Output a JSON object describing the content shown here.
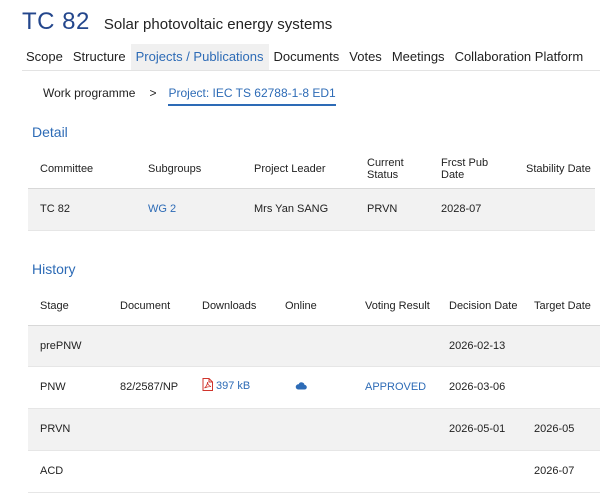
{
  "header": {
    "code": "TC 82",
    "title": "Solar photovoltaic energy systems"
  },
  "tabs": [
    "Scope",
    "Structure",
    "Projects / Publications",
    "Documents",
    "Votes",
    "Meetings",
    "Collaboration Platform"
  ],
  "active_tab": "Projects / Publications",
  "breadcrumb": {
    "home": "Work programme",
    "separator": ">",
    "current": "Project: IEC TS 62788-1-8 ED1"
  },
  "detail": {
    "title": "Detail",
    "headers": [
      "Committee",
      "Subgroups",
      "Project Leader",
      "Current Status",
      "Frcst Pub Date",
      "Stability Date"
    ],
    "row": {
      "committee": "TC 82",
      "subgroup": "WG 2",
      "leader": "Mrs Yan SANG",
      "status": "PRVN",
      "pub_date": "2028-07",
      "stability": ""
    }
  },
  "history": {
    "title": "History",
    "headers": [
      "Stage",
      "Document",
      "Downloads",
      "Online",
      "Voting Result",
      "Decision Date",
      "Target Date"
    ],
    "rows": [
      {
        "stage": "prePNW",
        "document": "",
        "download": "",
        "online": "",
        "voting": "",
        "decision": "2026-02-13",
        "target": ""
      },
      {
        "stage": "PNW",
        "document": "82/2587/NP",
        "download": "397 kB",
        "online": "cloud-icon",
        "voting": "APPROVED",
        "decision": "2026-03-06",
        "target": ""
      },
      {
        "stage": "PRVN",
        "document": "",
        "download": "",
        "online": "",
        "voting": "",
        "decision": "2026-05-01",
        "target": "2026-05"
      },
      {
        "stage": "ACD",
        "document": "",
        "download": "",
        "online": "",
        "voting": "",
        "decision": "",
        "target": "2026-07"
      }
    ]
  },
  "icons": {
    "pdf": "pdf-file-icon",
    "online": "cloud-icon"
  },
  "colors": {
    "brand": "#23468c",
    "link": "#2d6bb6",
    "pdf_red": "#d0342c",
    "row_shade": "#f2f2f2"
  }
}
